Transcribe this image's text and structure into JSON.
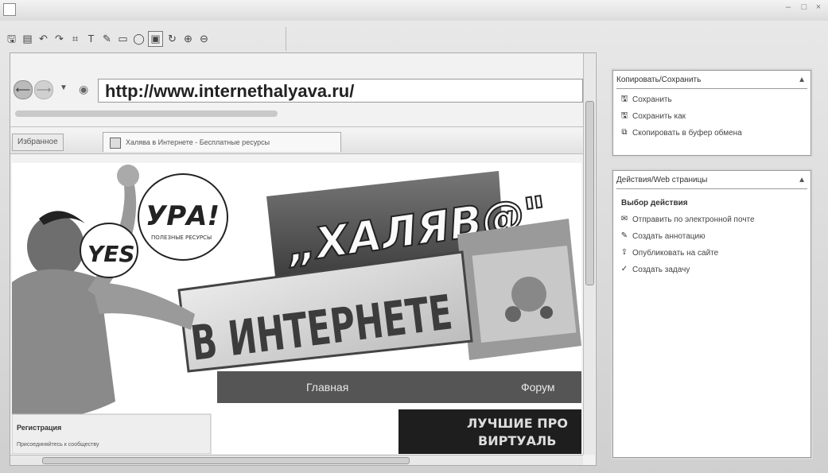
{
  "toolbar": {
    "tools": [
      "save-icon",
      "open-icon",
      "undo-icon",
      "redo-icon",
      "crop-icon",
      "text-icon",
      "pen-icon",
      "rectangle-icon",
      "ellipse-icon",
      "select-icon",
      "refresh-icon",
      "zoom-in-icon",
      "zoom-out-icon"
    ],
    "tool_glyphs": [
      "🖫",
      "▤",
      "↶",
      "↷",
      "⌗",
      "T",
      "✎",
      "▭",
      "◯",
      "▣",
      "↻",
      "⊕",
      "⊖"
    ]
  },
  "browser": {
    "url": "http://www.internethalyava.ru/",
    "favorites_label": "Избранное",
    "tab_title": "Халява в Интернете - Бесплатные ресурсы"
  },
  "banner": {
    "yes_bubble": "YES",
    "ura_bubble": "УРА!",
    "ura_sub": "ПОЛЕЗНЫЕ РЕСУРСЫ",
    "logo_top": "„ХАЛЯВ@\"",
    "logo_bottom": "В ИНТЕРНЕТЕ",
    "nav_main": "Главная",
    "nav_forum": "Форум",
    "promo_line1": "ЛУЧШИЕ ПРО",
    "promo_line2": "ВИРТУАЛЬ",
    "side_box_title": "Регистрация",
    "side_box_text": "Присоединяйтесь к сообществу"
  },
  "panel_save": {
    "title": "Копировать/Сохранить",
    "items": [
      "Сохранить",
      "Сохранить как",
      "Скопировать в буфер обмена"
    ],
    "icons": [
      "save-icon",
      "save-as-icon",
      "clipboard-icon"
    ],
    "glyphs": [
      "🖫",
      "🖫",
      "⧉"
    ]
  },
  "panel_actions": {
    "title": "Действия/Web страницы",
    "subtitle": "Выбор действия",
    "items": [
      "Отправить по электронной почте",
      "Создать аннотацию",
      "Опубликовать на сайте",
      "Создать задачу"
    ],
    "icons": [
      "email-icon",
      "annotation-icon",
      "publish-icon",
      "task-icon"
    ],
    "glyphs": [
      "✉",
      "✎",
      "⇪",
      "✓"
    ]
  }
}
